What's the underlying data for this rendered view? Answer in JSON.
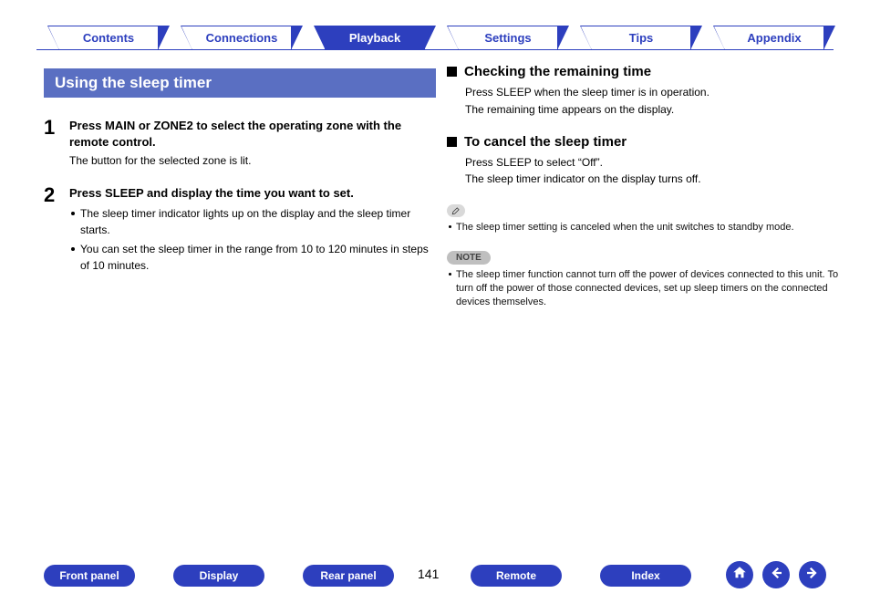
{
  "nav": {
    "tabs": [
      {
        "label": "Contents",
        "active": false
      },
      {
        "label": "Connections",
        "active": false
      },
      {
        "label": "Playback",
        "active": true
      },
      {
        "label": "Settings",
        "active": false
      },
      {
        "label": "Tips",
        "active": false
      },
      {
        "label": "Appendix",
        "active": false
      }
    ]
  },
  "left": {
    "title": "Using the sleep timer",
    "steps": [
      {
        "num": "1",
        "head": "Press MAIN or ZONE2 to select the operating zone with the remote control.",
        "sub": "The button for the selected zone is lit."
      },
      {
        "num": "2",
        "head": "Press SLEEP and display the time you want to set.",
        "bullets": [
          "The sleep timer indicator lights up on the display and the sleep timer starts.",
          "You can set the sleep timer in the range from 10 to 120 minutes in steps of 10 minutes."
        ]
      }
    ]
  },
  "right": {
    "sections": [
      {
        "title": "Checking the remaining time",
        "lines": [
          "Press SLEEP when the sleep timer is in operation.",
          "The remaining time appears on the display."
        ]
      },
      {
        "title": "To cancel the sleep timer",
        "lines": [
          "Press SLEEP to select “Off”.",
          "The sleep timer indicator on the display turns off."
        ]
      }
    ],
    "tip_bullets": [
      "The sleep timer setting is canceled when the unit switches to standby mode."
    ],
    "note_label": "NOTE",
    "note_bullets": [
      "The sleep timer function cannot turn off the power of devices connected to this unit. To turn off the power of those connected devices, set up sleep timers on the connected devices themselves."
    ]
  },
  "bottom": {
    "buttons": [
      "Front panel",
      "Display",
      "Rear panel",
      "Remote",
      "Index"
    ],
    "page": "141"
  }
}
